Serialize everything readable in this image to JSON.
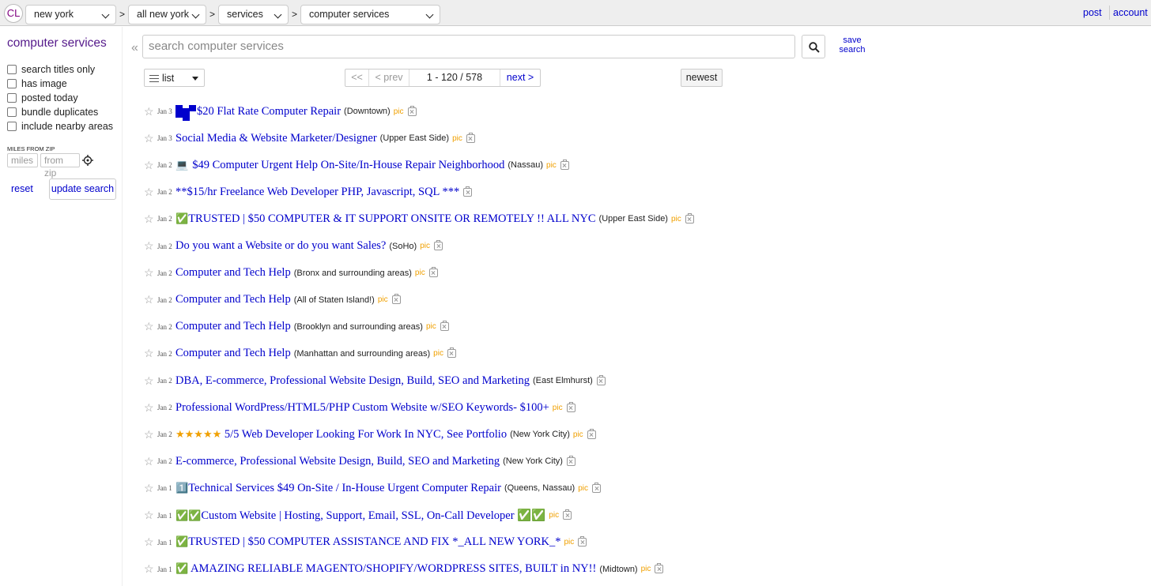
{
  "topbar": {
    "logo": "CL",
    "breadcrumbs": [
      "new york",
      "all new york",
      "services",
      "computer services"
    ],
    "separator": ">",
    "post_link": "post",
    "account_link": "account"
  },
  "sidebar": {
    "category_title": "computer services",
    "filters": [
      "search titles only",
      "has image",
      "posted today",
      "bundle duplicates",
      "include nearby areas"
    ],
    "miles_label": "MILES FROM ZIP",
    "miles_placeholder": "miles",
    "zip_placeholder": "from zip",
    "reset_label": "reset",
    "update_label": "update search"
  },
  "search": {
    "collapse_glyph": "«",
    "placeholder": "search computer services",
    "save_label_1": "save",
    "save_label_2": "search"
  },
  "controls": {
    "view_label": "list",
    "pager": {
      "first": "<<",
      "prev": "< prev",
      "range": "1 - 120 / 578",
      "next": "next >"
    },
    "sort_label": "newest"
  },
  "listings": [
    {
      "date": "Jan 3",
      "prefix": "",
      "title": "$20 Flat Rate Computer Repair",
      "hood": "(Downtown)",
      "pic": "pic"
    },
    {
      "date": "Jan 3",
      "prefix": "",
      "title": "Social Media & Website Marketer/Designer",
      "hood": "(Upper East Side)",
      "pic": "pic"
    },
    {
      "date": "Jan 2",
      "prefix": "💻",
      "title": "$49 Computer Urgent Help On-Site/In-House Repair Neighborhood",
      "hood": "(Nassau)",
      "pic": "pic"
    },
    {
      "date": "Jan 2",
      "prefix": "",
      "title": "**$15/hr Freelance Web Developer PHP, Javascript, SQL ***",
      "hood": "",
      "pic": ""
    },
    {
      "date": "Jan 2",
      "prefix": "✅",
      "title": "TRUSTED | $50 COMPUTER & IT SUPPORT ONSITE OR REMOTELY !! ALL NYC",
      "hood": "(Upper East Side)",
      "pic": "pic"
    },
    {
      "date": "Jan 2",
      "prefix": "",
      "title": "Do you want a Website or do you want Sales?",
      "hood": "(SoHo)",
      "pic": "pic"
    },
    {
      "date": "Jan 2",
      "prefix": "",
      "title": "Computer and Tech Help",
      "hood": "(Bronx and surrounding areas)",
      "pic": "pic"
    },
    {
      "date": "Jan 2",
      "prefix": "",
      "title": "Computer and Tech Help",
      "hood": "(All of Staten Island!)",
      "pic": "pic"
    },
    {
      "date": "Jan 2",
      "prefix": "",
      "title": "Computer and Tech Help",
      "hood": "(Brooklyn and surrounding areas)",
      "pic": "pic"
    },
    {
      "date": "Jan 2",
      "prefix": "",
      "title": "Computer and Tech Help",
      "hood": "(Manhattan and surrounding areas)",
      "pic": "pic"
    },
    {
      "date": "Jan 2",
      "prefix": "",
      "title": "DBA, E-commerce, Professional Website Design, Build, SEO and Marketing",
      "hood": "(East Elmhurst)",
      "pic": ""
    },
    {
      "date": "Jan 2",
      "prefix": "",
      "title": "Professional WordPress/HTML5/PHP Custom Website w/SEO Keywords- $100+",
      "hood": "",
      "pic": "pic"
    },
    {
      "date": "Jan 2",
      "prefix": "★★★★★",
      "title": " 5/5 Web Developer Looking For Work In NYC, See Portfolio",
      "hood": "(New York City)",
      "pic": "pic"
    },
    {
      "date": "Jan 2",
      "prefix": "",
      "title": "E-commerce, Professional Website Design, Build, SEO and Marketing",
      "hood": "(New York City)",
      "pic": ""
    },
    {
      "date": "Jan 1",
      "prefix": "1️⃣",
      "title": "Technical Services $49 On-Site / In-House Urgent Computer Repair",
      "hood": "(Queens, Nassau)",
      "pic": "pic"
    },
    {
      "date": "Jan 1",
      "prefix": "✅✅",
      "title": "Custom Website | Hosting, Support, Email, SSL, On-Call Developer ✅✅",
      "hood": "",
      "pic": "pic"
    },
    {
      "date": "Jan 1",
      "prefix": "✅",
      "title": "TRUSTED | $50 COMPUTER ASSISTANCE AND FIX *_ALL NEW YORK_*",
      "hood": "",
      "pic": "pic"
    },
    {
      "date": "Jan 1",
      "prefix": "✅",
      "title": " AMAZING RELIABLE MAGENTO/SHOPIFY/WORDPRESS SITES, BUILT in NY!!",
      "hood": "(Midtown)",
      "pic": "pic"
    }
  ],
  "colors": {
    "link": "#0000cc",
    "visited_title": "#551a8b",
    "pic_label": "#f0a000",
    "star_rating": "#f0a000",
    "checkmark": "#22aa22"
  }
}
